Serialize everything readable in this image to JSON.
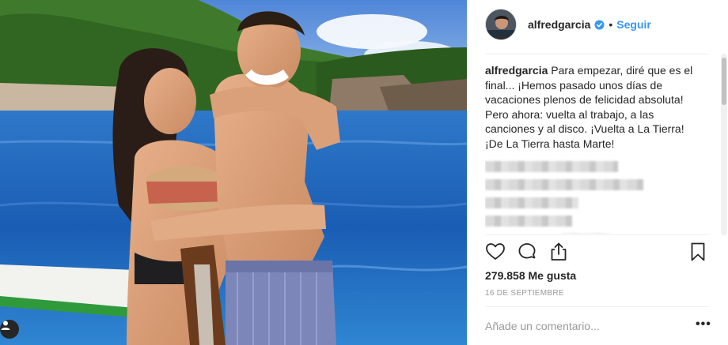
{
  "post": {
    "username": "alfredgarcia",
    "follow_label": "Seguir",
    "separator": "•",
    "caption_user": "alfredgarcia",
    "caption_text": "Para empezar, diré que es el final... ¡Hemos pasado unos días de vacaciones plenos de felicidad absoluta! Pero ahora: vuelta al trabajo, a las canciones y al disco. ¡Vuelta a La Tierra! ¡De La Tierra hasta Marte!",
    "likes": "279.858 Me gusta",
    "date": "16 DE SEPTIEMBRE",
    "comment_placeholder": "Añade un comentario...",
    "more_label": "•••"
  },
  "icons": {
    "verified": "verified-badge-icon",
    "like": "heart-icon",
    "comment": "speech-bubble-icon",
    "share": "share-icon",
    "save": "bookmark-icon",
    "tag": "person-tag-icon"
  },
  "colors": {
    "link": "#3897f0",
    "text": "#262626",
    "muted": "#999999",
    "border": "#efefef"
  }
}
